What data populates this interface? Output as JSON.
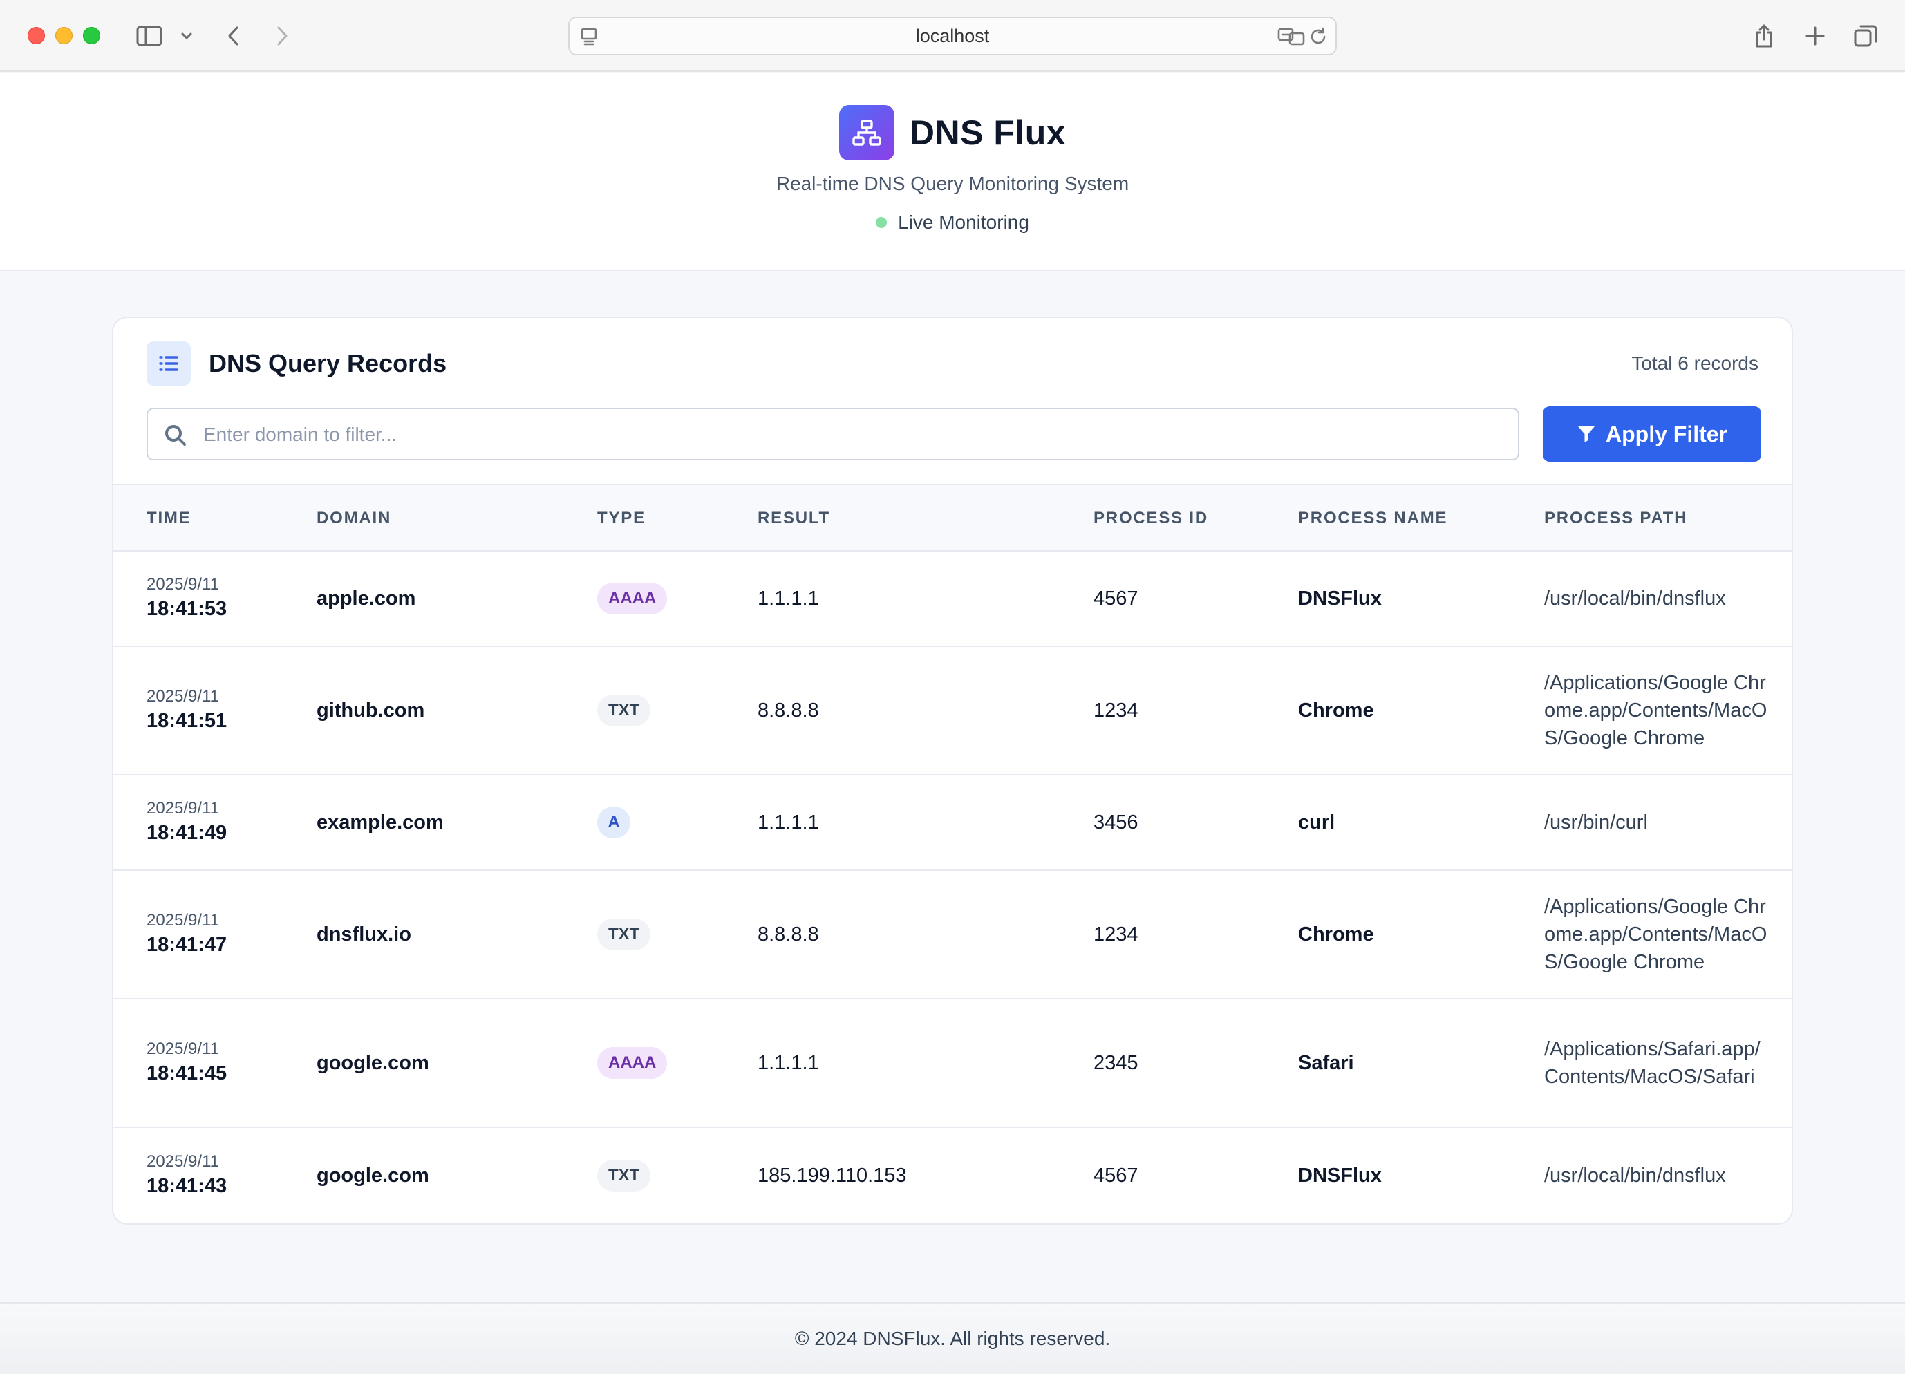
{
  "browser": {
    "url": "localhost"
  },
  "header": {
    "title": "DNS Flux",
    "subtitle": "Real-time DNS Query Monitoring System",
    "status": "Live Monitoring",
    "logo_icon": "network-icon",
    "status_color": "#86e0a4"
  },
  "records": {
    "title": "DNS Query Records",
    "total": "Total 6 records",
    "search_placeholder": "Enter domain to filter...",
    "search_value": "",
    "apply_label": "Apply Filter",
    "columns": [
      "TIME",
      "DOMAIN",
      "TYPE",
      "RESULT",
      "PROCESS ID",
      "PROCESS NAME",
      "PROCESS PATH"
    ],
    "rows": [
      {
        "date": "2025/9/11",
        "time": "18:41:53",
        "domain": "apple.com",
        "type": "AAAA",
        "result": "1.1.1.1",
        "pid": "4567",
        "pname": "DNSFlux",
        "path": "/usr/local/bin/dnsflux"
      },
      {
        "date": "2025/9/11",
        "time": "18:41:51",
        "domain": "github.com",
        "type": "TXT",
        "result": "8.8.8.8",
        "pid": "1234",
        "pname": "Chrome",
        "path": "/Applications/Google Chrome.app/Contents/MacOS/Google Chrome"
      },
      {
        "date": "2025/9/11",
        "time": "18:41:49",
        "domain": "example.com",
        "type": "A",
        "result": "1.1.1.1",
        "pid": "3456",
        "pname": "curl",
        "path": "/usr/bin/curl"
      },
      {
        "date": "2025/9/11",
        "time": "18:41:47",
        "domain": "dnsflux.io",
        "type": "TXT",
        "result": "8.8.8.8",
        "pid": "1234",
        "pname": "Chrome",
        "path": "/Applications/Google Chrome.app/Contents/MacOS/Google Chrome"
      },
      {
        "date": "2025/9/11",
        "time": "18:41:45",
        "domain": "google.com",
        "type": "AAAA",
        "result": "1.1.1.1",
        "pid": "2345",
        "pname": "Safari",
        "path": "/Applications/Safari.app/Contents/MacOS/Safari"
      },
      {
        "date": "2025/9/11",
        "time": "18:41:43",
        "domain": "google.com",
        "type": "TXT",
        "result": "185.199.110.153",
        "pid": "4567",
        "pname": "DNSFlux",
        "path": "/usr/local/bin/dnsflux"
      }
    ]
  },
  "footer": {
    "text": "© 2024 DNSFlux. All rights reserved."
  },
  "colors": {
    "accent": "#2f63eb",
    "aaaa_badge": "#f1e4fb",
    "a_badge": "#e2ebfc",
    "txt_badge": "#f1f3f6"
  }
}
